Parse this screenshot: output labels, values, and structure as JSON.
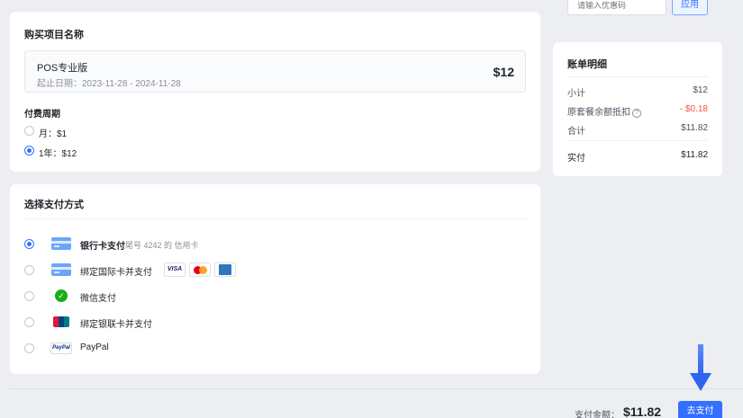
{
  "coupon": {
    "placeholder": "请输入优惠码",
    "apply_label": "应用"
  },
  "product": {
    "section_title": "购买项目名称",
    "name": "POS专业版",
    "dates": "起止日期：2023-11-28 - 2024-11-28",
    "price": "$12",
    "cycle_label": "付费周期",
    "cycles": [
      {
        "label": "月：$1",
        "selected": false
      },
      {
        "label": "1年：$12",
        "selected": true
      }
    ]
  },
  "payment": {
    "section_title": "选择支付方式",
    "methods": [
      {
        "label": "银行卡支付",
        "sub": "尾号 4242 的 信用卡",
        "icon": "bank-card-icon",
        "selected": true
      },
      {
        "label": "绑定国际卡并支付",
        "icon": "bank-card-icon",
        "brands": [
          "VISA",
          "mastercard-icon",
          "amex-icon"
        ],
        "selected": false
      },
      {
        "label": "微信支付",
        "icon": "wechat-pay-icon",
        "selected": false
      },
      {
        "label": "绑定银联卡并支付",
        "icon": "unionpay-icon",
        "selected": false
      },
      {
        "label": "PayPal",
        "icon": "paypal-icon",
        "icon_text": "PayPal",
        "selected": false
      }
    ]
  },
  "bill": {
    "title": "账单明细",
    "rows": [
      {
        "label": "小计",
        "value": "$12"
      },
      {
        "label": "原套餐余额抵扣",
        "value": "- $0.18",
        "help": "?"
      },
      {
        "label": "合计",
        "value": "$11.82"
      },
      {
        "label": "实付",
        "value": "$11.82"
      }
    ]
  },
  "footer": {
    "amount_label": "支付金额：",
    "amount": "$11.82",
    "pay_label": "去支付"
  },
  "colors": {
    "accent": "#3370ff",
    "discount": "#f5563d",
    "background": "#eceef2"
  }
}
